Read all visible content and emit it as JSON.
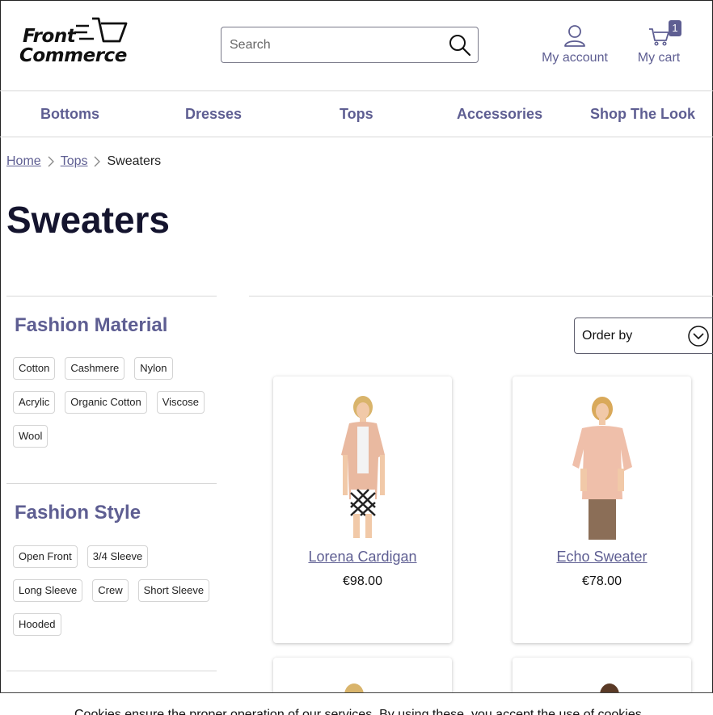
{
  "header": {
    "logo": {
      "line1": "Front",
      "line2": "Commerce"
    },
    "search": {
      "placeholder": "Search"
    },
    "account_label": "My account",
    "cart_label": "My cart",
    "cart_count": "1"
  },
  "nav": {
    "items": [
      "Bottoms",
      "Dresses",
      "Tops",
      "Accessories",
      "Shop The Look"
    ]
  },
  "breadcrumb": {
    "items": [
      "Home",
      "Tops"
    ],
    "current": "Sweaters"
  },
  "page_title": "Sweaters",
  "filters": [
    {
      "title": "Fashion Material",
      "options": [
        "Cotton",
        "Cashmere",
        "Nylon",
        "Acrylic",
        "Organic Cotton",
        "Viscose",
        "Wool"
      ]
    },
    {
      "title": "Fashion Style",
      "options": [
        "Open Front",
        "3/4 Sleeve",
        "Long Sleeve",
        "Crew",
        "Short Sleeve",
        "Hooded"
      ]
    }
  ],
  "order_by": {
    "label": "Order by"
  },
  "products": [
    {
      "name": "Lorena Cardigan",
      "price": "€98.00"
    },
    {
      "name": "Echo Sweater",
      "price": "€78.00"
    }
  ],
  "cookie_banner": {
    "text": "Cookies ensure the proper operation of our services. By using these, you accept the use of cookies."
  },
  "colors": {
    "accent": "#5e5e92",
    "title": "#14142e",
    "border": "#d8d8d8"
  }
}
